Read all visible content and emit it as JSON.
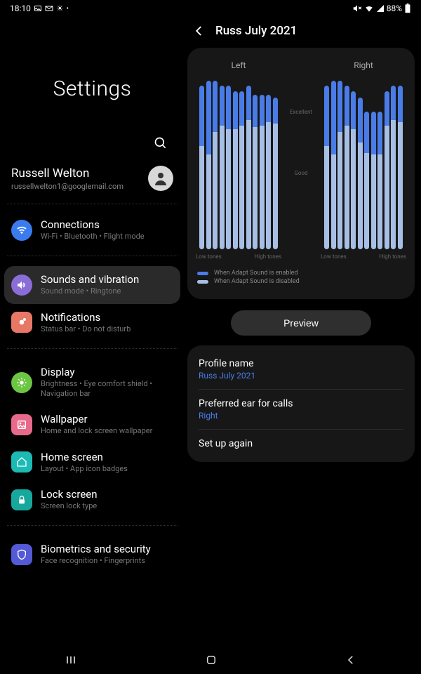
{
  "status": {
    "time": "18:10",
    "battery": "88%"
  },
  "settings": {
    "title": "Settings",
    "profile": {
      "name": "Russell Welton",
      "email": "russellwelton1@googlemail.com"
    },
    "items": [
      {
        "label": "Connections",
        "sub": "Wi-Fi • Bluetooth • Flight mode"
      },
      {
        "label": "Sounds and vibration",
        "sub": "Sound mode • Ringtone"
      },
      {
        "label": "Notifications",
        "sub": "Status bar • Do not disturb"
      },
      {
        "label": "Display",
        "sub": "Brightness • Eye comfort shield • Navigation bar"
      },
      {
        "label": "Wallpaper",
        "sub": "Home and lock screen wallpaper"
      },
      {
        "label": "Home screen",
        "sub": "Layout • App icon badges"
      },
      {
        "label": "Lock screen",
        "sub": "Screen lock type"
      },
      {
        "label": "Biometrics and security",
        "sub": "Face recognition • Fingerprints"
      }
    ]
  },
  "right": {
    "title": "Russ July 2021",
    "chart": {
      "left_label": "Left",
      "right_label": "Right",
      "excellent": "Excellent",
      "good": "Good",
      "low_tones": "Low tones",
      "high_tones": "High tones"
    },
    "legend": {
      "enabled": "When Adapt Sound is enabled",
      "disabled": "When Adapt Sound is disabled"
    },
    "preview": "Preview",
    "details": {
      "profile_label": "Profile name",
      "profile_value": "Russ July 2021",
      "ear_label": "Preferred ear for calls",
      "ear_value": "Right",
      "setup": "Set up again"
    }
  },
  "chart_data": {
    "type": "bar",
    "description": "Adapt Sound hearing profile — enabled vs disabled per frequency band",
    "y_axis_markers": [
      "Good",
      "Excellent"
    ],
    "x_axis": "Low tones → High tones",
    "series_names": [
      "When Adapt Sound is enabled",
      "When Adapt Sound is disabled"
    ],
    "left_ear": {
      "enabled": [
        95,
        98,
        98,
        95,
        95,
        92,
        92,
        95,
        90,
        90,
        90,
        88
      ],
      "disabled": [
        60,
        55,
        68,
        72,
        70,
        70,
        72,
        75,
        71,
        72,
        74,
        73
      ]
    },
    "right_ear": {
      "enabled": [
        95,
        98,
        98,
        95,
        92,
        88,
        80,
        80,
        80,
        92,
        95,
        95
      ],
      "disabled": [
        60,
        55,
        68,
        72,
        70,
        62,
        56,
        55,
        55,
        72,
        75,
        74
      ]
    }
  }
}
